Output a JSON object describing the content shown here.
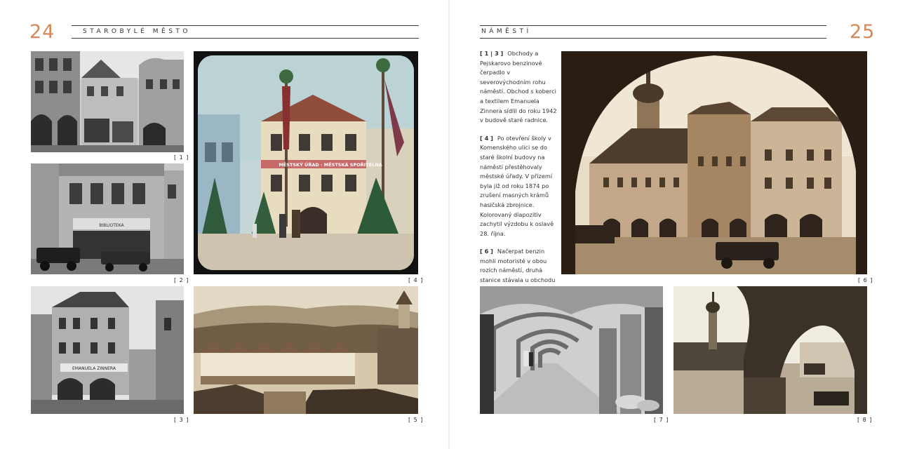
{
  "left_page": {
    "page_number": "24",
    "header": "STAROBYLÉ MĚSTO"
  },
  "right_page": {
    "page_number": "25",
    "header": "NÁMĚSTÍ"
  },
  "captions": {
    "c1": "[ 1 ]",
    "c2": "[ 2 ]",
    "c3": "[ 3 ]",
    "c4": "[ 4 ]",
    "c5": "[ 5 ]",
    "c6": "[ 6 ]",
    "c7": "[ 7 ]",
    "c8": "[ 8 ]"
  },
  "signs": {
    "photo2_shop": "BIBLIOTEKA",
    "photo3_shop": "EMANUELA ZINNERA",
    "photo4_banner": "MĚSTSKÝ ÚŘAD · MĚSTSKÁ SPOŘITELNA"
  },
  "text_blocks": [
    {
      "ref": "[ 1 | 3 ]",
      "body": "Obchody a Pejskarovo benzinové čerpadlo v severovýchodním rohu náměstí. Obchod s koberci a textilem Emanuela Zinnera sídlil do roku 1942 v budově staré radnice."
    },
    {
      "ref": "[ 4 ]",
      "body": "Po otevření školy v Komenského ulici se do staré školní budovy na náměstí přestěhovaly městské úřady. V přízemí byla již od roku 1874 po zrušení masných krámů hasičská zbrojnice. Kolorovaný diapozitiv zachytil výzdobu k oslavě 28. října."
    },
    {
      "ref": "[ 6 ]",
      "body": "Načerpat benzin mohli motoristé v obou rozích náměstí, druhá stanice stávala u obchodu pana Koska."
    }
  ],
  "colors": {
    "accent": "#d4895a",
    "rule": "#3a3a3a",
    "sepia": "#b08b63"
  }
}
